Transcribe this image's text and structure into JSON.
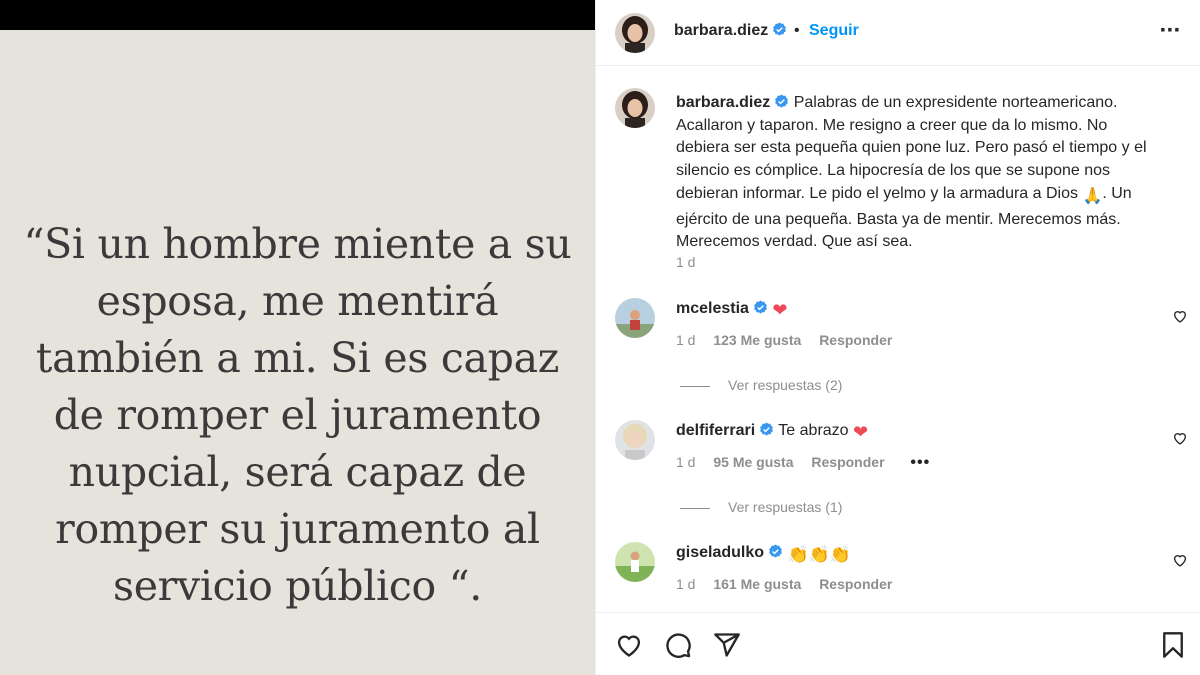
{
  "image": {
    "quote": "“Si un hombre miente a su esposa, me mentirá también a mi. Si es capaz de romper el juramento nupcial, será capaz de romper su juramento al servicio público “."
  },
  "header": {
    "username": "barbara.diez",
    "separator": "•",
    "follow_label": "Seguir",
    "more_icon": "more-options-icon"
  },
  "caption": {
    "username": "barbara.diez",
    "text_before_emoji": "Palabras de un expresidente norteamericano. Acallaron y taparon. Me resigno a creer que da lo mismo. No debiera ser esta pequeña quien pone luz. Pero pasó el tiempo y el silencio es cómplice. La hipocresía de los que se supone nos debieran informar. Le pido el yelmo y la armadura a Dios",
    "emoji": "🙏",
    "text_after_emoji": ". Un ejército de una pequeña. Basta ya de mentir. Merecemos más. Merecemos verdad. Que así sea.",
    "time": "1 d"
  },
  "comments": [
    {
      "username": "mcelestia",
      "text": "",
      "emoji": "❤",
      "time": "1 d",
      "likes": "123 Me gusta",
      "reply_label": "Responder",
      "view_replies": "Ver respuestas (2)"
    },
    {
      "username": "delfiferrari",
      "text": "Te abrazo",
      "emoji": "❤",
      "time": "1 d",
      "likes": "95 Me gusta",
      "reply_label": "Responder",
      "more": "•••",
      "view_replies": "Ver respuestas (1)"
    },
    {
      "username": "giseladulko",
      "text": "",
      "emoji": "👏👏👏",
      "time": "1 d",
      "likes": "161 Me gusta",
      "reply_label": "Responder"
    }
  ],
  "actions": {
    "like_icon": "heart-icon",
    "comment_icon": "comment-icon",
    "share_icon": "share-icon",
    "save_icon": "bookmark-icon"
  },
  "colors": {
    "accent": "#0095f6",
    "verified": "#3897f0",
    "heart_red": "#ed4956",
    "muted": "#8e8e8e",
    "image_bg": "#e6e2dc"
  }
}
